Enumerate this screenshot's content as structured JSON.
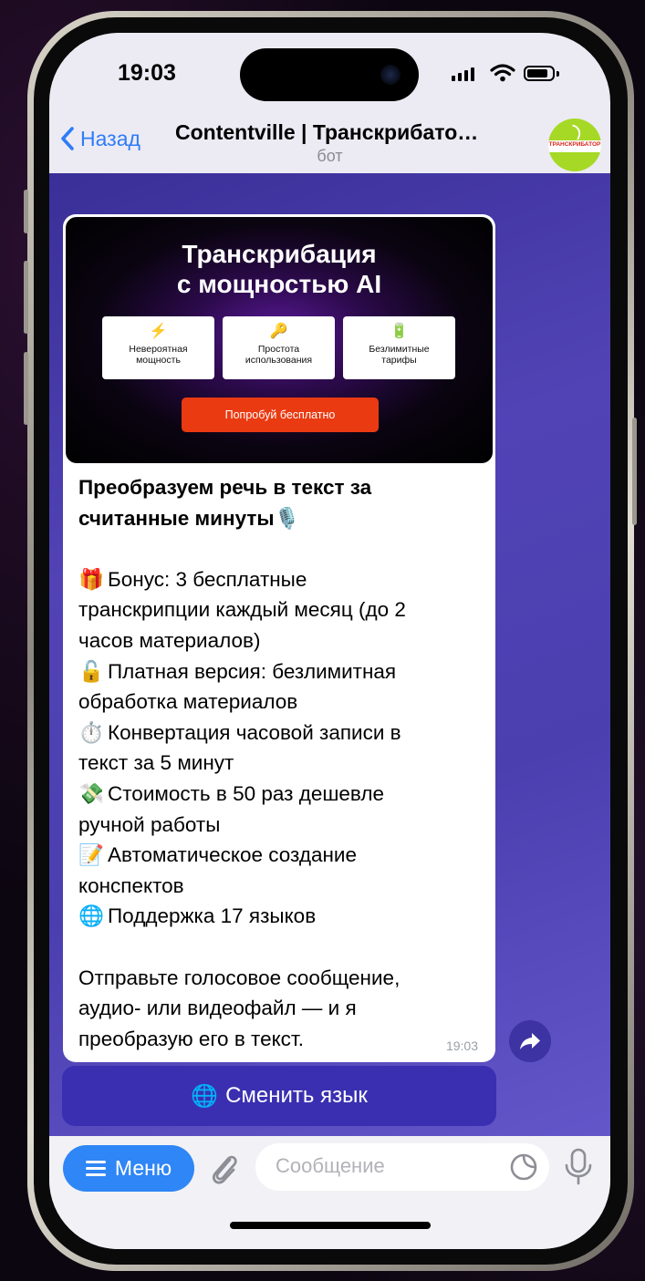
{
  "status_bar": {
    "time": "19:03"
  },
  "header": {
    "back_label": "Назад",
    "title": "Contentville | Транскрибато…",
    "subtitle": "бот",
    "avatar_text": "ТРАНСКРИБАТОР"
  },
  "message": {
    "banner": {
      "title_line1": "Транскрибация",
      "title_line2": "с мощностью AI",
      "features": [
        {
          "icon": "⚡",
          "label": "Невероятная\nмощность"
        },
        {
          "icon": "🔑",
          "label": "Простота\nиспользования"
        },
        {
          "icon": "🔋",
          "label": "Безлимитные\nтарифы"
        }
      ],
      "cta": "Попробуй бесплатно"
    },
    "heading_line1": "Преобразуем речь в текст за",
    "heading_line2": "считанные минуты🎙️",
    "items": [
      {
        "emoji": "🎁",
        "lines": [
          "Бонус: 3 бесплатные",
          "транскрипции каждый месяц (до 2",
          "часов материалов)"
        ]
      },
      {
        "emoji": "🔓",
        "lines": [
          "Платная версия: безлимитная",
          "обработка материалов"
        ]
      },
      {
        "emoji": "⏱️",
        "lines": [
          "Конвертация часовой записи в",
          "текст за 5 минут"
        ]
      },
      {
        "emoji": "💸",
        "lines": [
          "Стоимость в 50 раз дешевле",
          "ручной работы"
        ]
      },
      {
        "emoji": "📝",
        "lines": [
          "Автоматическое создание",
          "конспектов"
        ]
      },
      {
        "emoji": "🌐",
        "lines": [
          "Поддержка 17 языков"
        ]
      }
    ],
    "footer_lines": [
      "Отправьте голосовое сообщение,",
      "аудио- или видеофайл — и я",
      "преобразую его в текст."
    ],
    "timestamp": "19:03"
  },
  "inline_button": {
    "icon": "🌐",
    "label": "Сменить язык"
  },
  "input_bar": {
    "menu_label": "Меню",
    "placeholder": "Сообщение"
  },
  "icons": [
    "back-chevron-icon",
    "paperclip-icon",
    "sticker-icon",
    "microphone-icon",
    "share-arrow-icon"
  ],
  "colors": {
    "accent": "#2f86f6",
    "chat_bg": "#4b3fb0",
    "cta": "#ea3a11"
  }
}
